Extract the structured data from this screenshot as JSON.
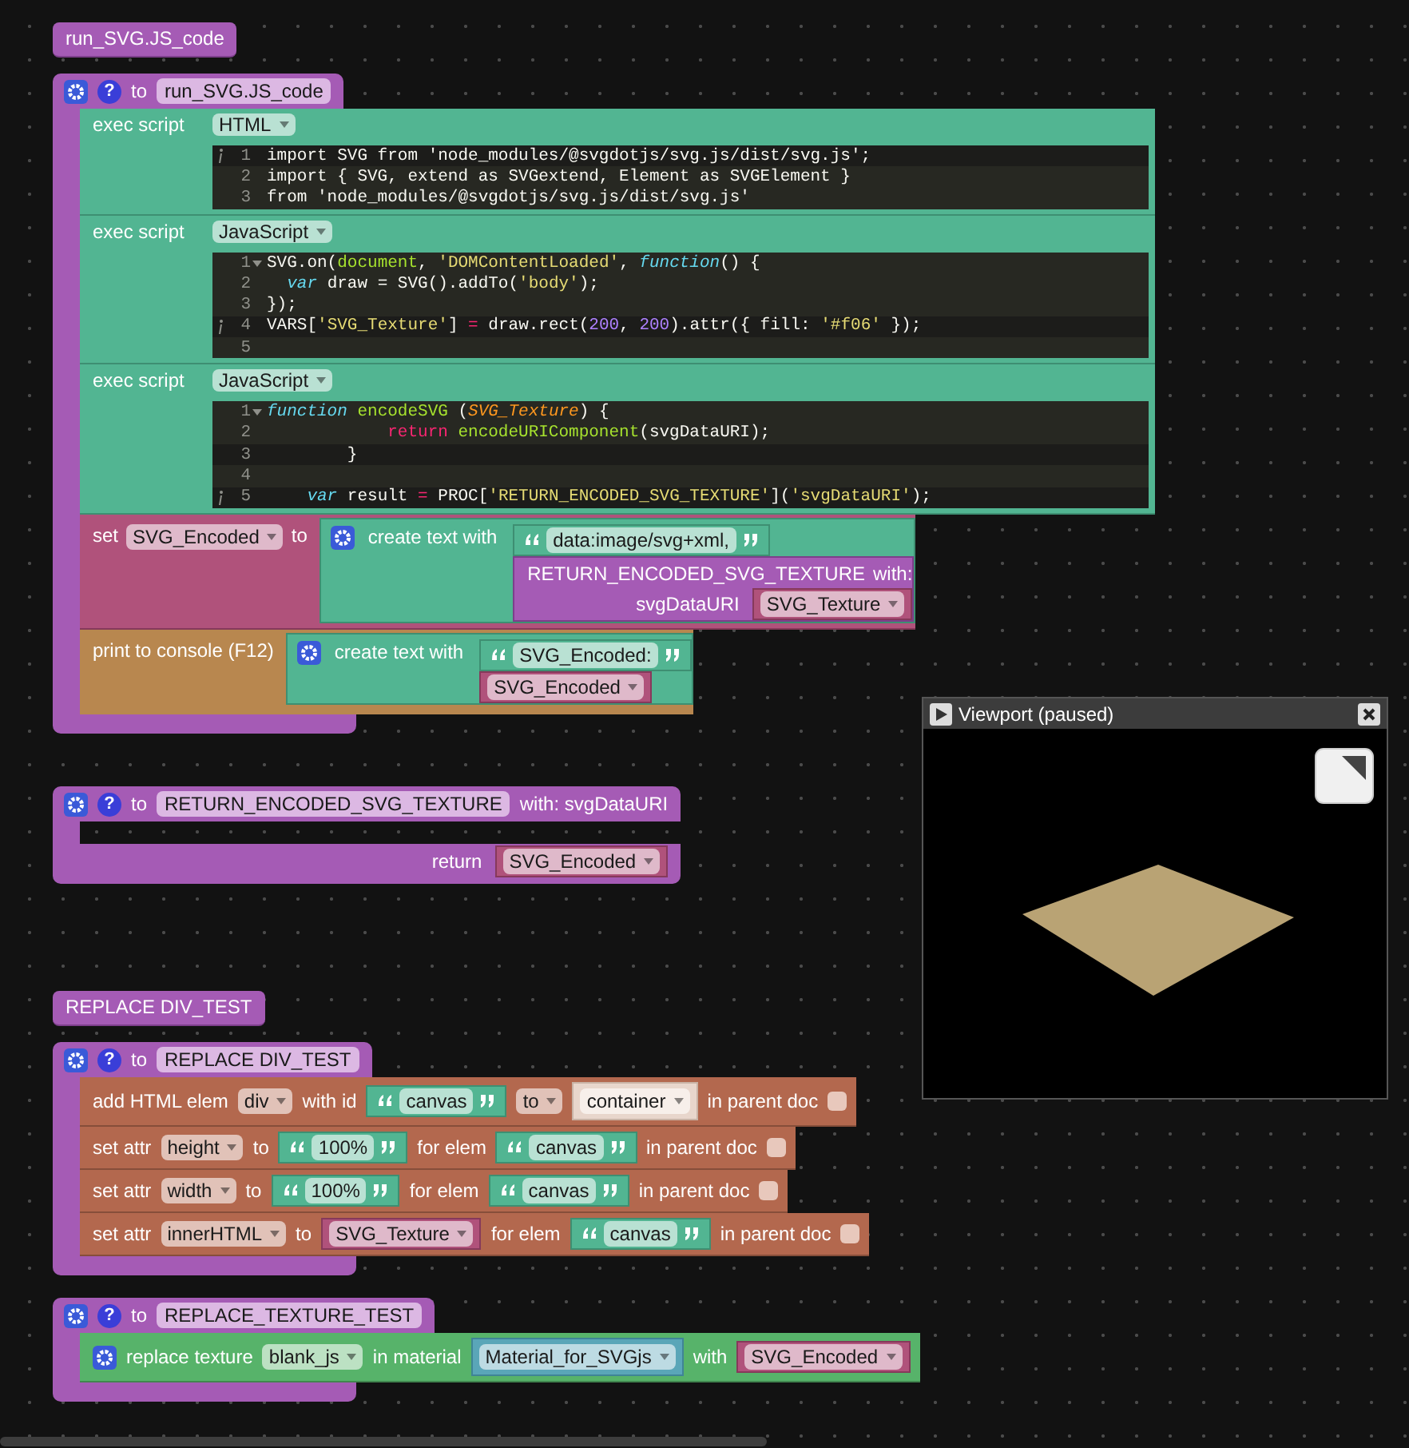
{
  "workspace": {
    "stacks": [
      {
        "kind": "call_stub",
        "name": "run_SVG.JS_code"
      },
      {
        "kind": "procedure",
        "help": "?",
        "to": "to",
        "name": "run_SVG.JS_code",
        "body": [
          {
            "kind": "exec_script",
            "label": "exec script",
            "language": "HTML",
            "lines": [
              {
                "number": "1",
                "info": true,
                "fold": false,
                "active": true,
                "tokens": [
                  {
                    "kind": "plain",
                    "text": "import SVG from 'node_modules/@svgdotjs/svg.js/dist/svg.js';"
                  }
                ]
              },
              {
                "number": "2",
                "info": false,
                "fold": false,
                "active": false,
                "tokens": [
                  {
                    "kind": "plain",
                    "text": "import { SVG, extend as SVGextend, Element as SVGElement }"
                  }
                ]
              },
              {
                "number": "3",
                "info": false,
                "fold": false,
                "active": false,
                "tokens": [
                  {
                    "kind": "plain",
                    "text": "from 'node_modules/@svgdotjs/svg.js/dist/svg.js'"
                  }
                ]
              }
            ]
          },
          {
            "kind": "exec_script",
            "label": "exec script",
            "language": "JavaScript",
            "lines": [
              {
                "number": "1",
                "info": false,
                "fold": true,
                "active": false,
                "tokens": [
                  {
                    "kind": "plain",
                    "text": "SVG.on("
                  },
                  {
                    "kind": "function",
                    "text": "document"
                  },
                  {
                    "kind": "plain",
                    "text": ", "
                  },
                  {
                    "kind": "string",
                    "text": "'DOMContentLoaded'"
                  },
                  {
                    "kind": "plain",
                    "text": ", "
                  },
                  {
                    "kind": "keyword",
                    "text": "function"
                  },
                  {
                    "kind": "plain",
                    "text": "() {"
                  }
                ]
              },
              {
                "number": "2",
                "info": false,
                "fold": false,
                "active": false,
                "tokens": [
                  {
                    "kind": "keyword",
                    "text": "  var"
                  },
                  {
                    "kind": "plain",
                    "text": " draw = SVG().addTo("
                  },
                  {
                    "kind": "string",
                    "text": "'body'"
                  },
                  {
                    "kind": "plain",
                    "text": ");"
                  }
                ]
              },
              {
                "number": "3",
                "info": false,
                "fold": false,
                "active": false,
                "tokens": [
                  {
                    "kind": "plain",
                    "text": "});"
                  }
                ]
              },
              {
                "number": "4",
                "info": true,
                "fold": false,
                "active": true,
                "tokens": [
                  {
                    "kind": "plain",
                    "text": "VARS["
                  },
                  {
                    "kind": "string",
                    "text": "'SVG_Texture'"
                  },
                  {
                    "kind": "plain",
                    "text": "] "
                  },
                  {
                    "kind": "operator",
                    "text": "="
                  },
                  {
                    "kind": "plain",
                    "text": " draw.rect("
                  },
                  {
                    "kind": "number",
                    "text": "200"
                  },
                  {
                    "kind": "plain",
                    "text": ", "
                  },
                  {
                    "kind": "number",
                    "text": "200"
                  },
                  {
                    "kind": "plain",
                    "text": ").attr({ fill: "
                  },
                  {
                    "kind": "string",
                    "text": "'#f06'"
                  },
                  {
                    "kind": "plain",
                    "text": " });"
                  }
                ]
              },
              {
                "number": "5",
                "info": false,
                "fold": false,
                "active": false
              }
            ]
          },
          {
            "kind": "exec_script",
            "label": "exec script",
            "language": "JavaScript",
            "lines": [
              {
                "number": "1",
                "info": false,
                "fold": true,
                "active": false,
                "tokens": [
                  {
                    "kind": "keyword",
                    "text": "function"
                  },
                  {
                    "kind": "function",
                    "text": " encodeSVG"
                  },
                  {
                    "kind": "plain",
                    "text": " ("
                  },
                  {
                    "kind": "param",
                    "text": "SVG_Texture"
                  },
                  {
                    "kind": "plain",
                    "text": ") {"
                  }
                ]
              },
              {
                "number": "2",
                "info": false,
                "fold": false,
                "active": false,
                "tokens": [
                  {
                    "kind": "operator",
                    "text": "            return"
                  },
                  {
                    "kind": "function",
                    "text": " encodeURIComponent"
                  },
                  {
                    "kind": "plain",
                    "text": "(svgDataURI);"
                  }
                ]
              },
              {
                "number": "3",
                "info": false,
                "fold": false,
                "active": true,
                "tokens": [
                  {
                    "kind": "plain",
                    "text": "        }"
                  }
                ]
              },
              {
                "number": "4",
                "info": false,
                "fold": false,
                "active": false
              },
              {
                "number": "5",
                "info": true,
                "fold": false,
                "active": true,
                "tokens": [
                  {
                    "kind": "keyword",
                    "text": "    var"
                  },
                  {
                    "kind": "plain",
                    "text": " result "
                  },
                  {
                    "kind": "operator",
                    "text": "="
                  },
                  {
                    "kind": "plain",
                    "text": " PROC["
                  },
                  {
                    "kind": "string",
                    "text": "'RETURN_ENCODED_SVG_TEXTURE'"
                  },
                  {
                    "kind": "plain",
                    "text": "]("
                  },
                  {
                    "kind": "string",
                    "text": "'svgDataURI'"
                  },
                  {
                    "kind": "plain",
                    "text": ");"
                  }
                ]
              }
            ]
          },
          {
            "kind": "set",
            "label": "set",
            "variable": "SVG_Encoded",
            "to": "to",
            "value": {
              "kind": "join",
              "label": "create text with",
              "items": [
                {
                  "kind": "text",
                  "value": "data:image/svg+xml,"
                },
                {
                  "kind": "call",
                  "name": "RETURN_ENCODED_SVG_TEXTURE",
                  "with": "with:",
                  "args": [
                    {
                      "name": "svgDataURI",
                      "value": {
                        "kind": "var",
                        "name": "SVG_Texture"
                      }
                    }
                  ]
                }
              ]
            }
          },
          {
            "kind": "print",
            "label": "print to console (F12)",
            "value": {
              "kind": "join",
              "label": "create text with",
              "items": [
                {
                  "kind": "text",
                  "value": "SVG_Encoded:"
                },
                {
                  "kind": "var",
                  "name": "SVG_Encoded"
                }
              ]
            }
          }
        ]
      },
      {
        "kind": "procedure",
        "help": "?",
        "to": "to",
        "name": "RETURN_ENCODED_SVG_TEXTURE",
        "params": "with: svgDataURI",
        "return": {
          "label": "return",
          "value": {
            "kind": "var",
            "name": "SVG_Encoded"
          }
        }
      },
      {
        "kind": "call_stub",
        "name": "REPLACE DIV_TEST"
      },
      {
        "kind": "procedure",
        "help": "?",
        "to": "to",
        "name": "REPLACE DIV_TEST",
        "body": [
          {
            "kind": "add_element",
            "parts": [
              {
                "kind": "label",
                "text": "add HTML elem"
              },
              {
                "kind": "dropdown",
                "text": "div"
              },
              {
                "kind": "label",
                "text": "with id"
              },
              {
                "kind": "text",
                "value": "canvas"
              },
              {
                "kind": "dropdown",
                "text": "to"
              },
              {
                "kind": "element_ref",
                "name": "container"
              },
              {
                "kind": "label",
                "text": "in parent doc"
              },
              {
                "kind": "checkbox",
                "checked": false
              }
            ]
          },
          {
            "kind": "set_attr",
            "parts": [
              {
                "kind": "label",
                "text": "set attr"
              },
              {
                "kind": "dropdown",
                "text": "height"
              },
              {
                "kind": "label",
                "text": "to"
              },
              {
                "kind": "text",
                "value": "100%"
              },
              {
                "kind": "label",
                "text": "for elem"
              },
              {
                "kind": "text",
                "value": "canvas"
              },
              {
                "kind": "label",
                "text": "in parent doc"
              },
              {
                "kind": "checkbox",
                "checked": false
              }
            ]
          },
          {
            "kind": "set_attr",
            "parts": [
              {
                "kind": "label",
                "text": "set attr"
              },
              {
                "kind": "dropdown",
                "text": "width"
              },
              {
                "kind": "label",
                "text": "to"
              },
              {
                "kind": "text",
                "value": "100%"
              },
              {
                "kind": "label",
                "text": "for elem"
              },
              {
                "kind": "text",
                "value": "canvas"
              },
              {
                "kind": "label",
                "text": "in parent doc"
              },
              {
                "kind": "checkbox",
                "checked": false
              }
            ]
          },
          {
            "kind": "set_attr",
            "parts": [
              {
                "kind": "label",
                "text": "set attr"
              },
              {
                "kind": "dropdown",
                "text": "innerHTML"
              },
              {
                "kind": "label",
                "text": "to"
              },
              {
                "kind": "var",
                "name": "SVG_Texture"
              },
              {
                "kind": "label",
                "text": "for elem"
              },
              {
                "kind": "text",
                "value": "canvas"
              },
              {
                "kind": "label",
                "text": "in parent doc"
              },
              {
                "kind": "checkbox",
                "checked": false
              }
            ]
          }
        ]
      },
      {
        "kind": "procedure",
        "help": "?",
        "to": "to",
        "name": "REPLACE_TEXTURE_TEST",
        "body": [
          {
            "kind": "replace_texture",
            "parts": [
              {
                "kind": "gear"
              },
              {
                "kind": "label",
                "text": "replace texture"
              },
              {
                "kind": "dropdown",
                "text": "blank_js"
              },
              {
                "kind": "label",
                "text": "in material"
              },
              {
                "kind": "material",
                "name": "Material_for_SVGjs"
              },
              {
                "kind": "label",
                "text": "with"
              },
              {
                "kind": "var",
                "name": "SVG_Encoded"
              }
            ]
          }
        ]
      }
    ]
  },
  "viewport": {
    "title": "Viewport (paused)"
  }
}
